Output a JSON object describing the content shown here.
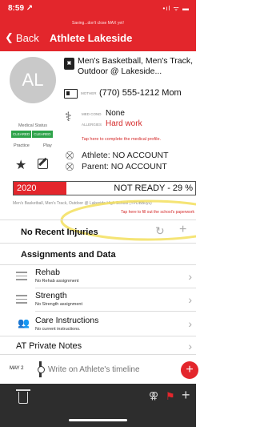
{
  "status_bar": {
    "time": "8:59 ↗",
    "saving_text": "Saving...don't close MAX yet!",
    "icons": "•ıl ᯤ ▬"
  },
  "nav": {
    "back_label": "Back",
    "title": "Athlete Lakeside"
  },
  "profile": {
    "initials": "AL",
    "sports": "Men's Basketball, Men's Track, Outdoor @ Lakeside...",
    "mother_label": "MOTHER",
    "mother_phone": "(770) 555-1212 Mom",
    "med_cond_label": "MED COND",
    "med_cond_value": "None",
    "allergies_label": "ALLERGIES",
    "allergies_value": "Hard work",
    "tap_medical": "Tap here to complete the medical profile."
  },
  "medical_status": {
    "label": "Medical Status",
    "practice_badge": "CLEARED",
    "play_badge": "CLEARED",
    "practice_label": "Practice",
    "play_label": "Play"
  },
  "accounts": {
    "athlete": "Athlete: NO ACCOUNT",
    "parent": "Parent: NO ACCOUNT"
  },
  "readiness": {
    "year": "2020",
    "status": "NOT READY - 29 %",
    "percent": 29,
    "team_info": "Men's Basketball, Men's Track, Outdoor @ Lakeside High School (YPDBBoys)",
    "tap_school": "Tap here to fill out the school's paperwork"
  },
  "injuries": {
    "title": "No Recent Injuries"
  },
  "assignments": {
    "title": "Assignments and Data",
    "items": [
      {
        "title": "Rehab",
        "subtitle": "No Rehab assignment"
      },
      {
        "title": "Strength",
        "subtitle": "No Strength assignment"
      },
      {
        "title": "Care Instructions",
        "subtitle": "No current instructions."
      }
    ]
  },
  "notes": {
    "title": "AT Private Notes"
  },
  "timeline": {
    "date": "MAY 2",
    "placeholder": "Write on Athlete's timeline"
  },
  "colors": {
    "accent": "#e3262c",
    "cleared": "#2ea34a",
    "highlight": "#f3df5d"
  }
}
